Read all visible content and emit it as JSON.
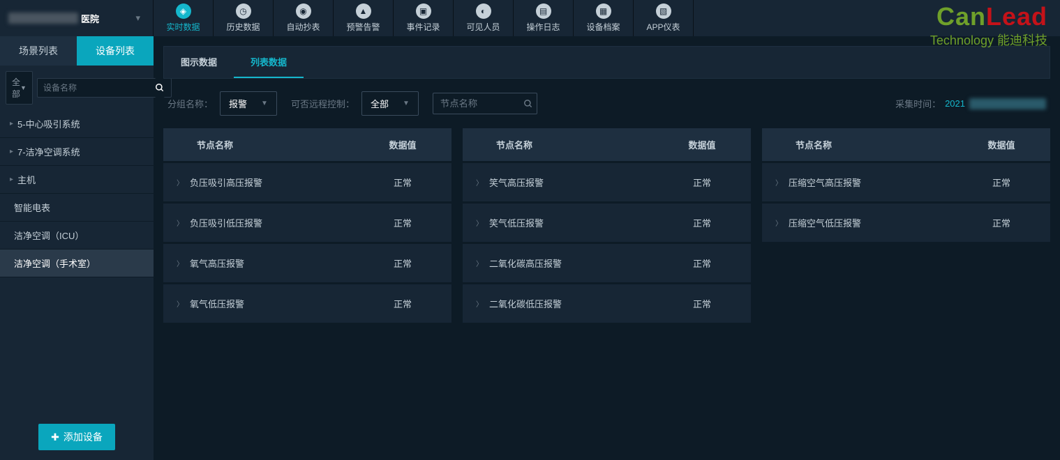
{
  "header": {
    "hospital_suffix": "医院",
    "nav": [
      {
        "label": "实时数据",
        "active": true
      },
      {
        "label": "历史数据",
        "active": false
      },
      {
        "label": "自动抄表",
        "active": false
      },
      {
        "label": "预警告警",
        "active": false
      },
      {
        "label": "事件记录",
        "active": false
      },
      {
        "label": "可见人员",
        "active": false
      },
      {
        "label": "操作日志",
        "active": false
      },
      {
        "label": "设备档案",
        "active": false
      },
      {
        "label": "APP仪表",
        "active": false
      }
    ],
    "logo_sub": "Technology 能迪科技"
  },
  "sidebar": {
    "tabs": [
      {
        "label": "场景列表",
        "active": false
      },
      {
        "label": "设备列表",
        "active": true
      }
    ],
    "filter_all": "全部",
    "search_placeholder": "设备名称",
    "tree": [
      {
        "label": "5-中心吸引系统",
        "selected": false,
        "caret": true
      },
      {
        "label": "7-洁净空调系统",
        "selected": false,
        "caret": true
      },
      {
        "label": "主机",
        "selected": false,
        "caret": true
      },
      {
        "label": "智能电表",
        "selected": false,
        "caret": false
      },
      {
        "label": "洁净空调（ICU）",
        "selected": false,
        "caret": false
      },
      {
        "label": "洁净空调（手术室）",
        "selected": true,
        "caret": false
      }
    ],
    "add_device": "添加设备"
  },
  "main": {
    "sub_tabs": [
      {
        "label": "图示数据",
        "active": false
      },
      {
        "label": "列表数据",
        "active": true
      }
    ],
    "filters": {
      "group_label": "分组名称：",
      "group_value": "报警",
      "remote_label": "可否远程控制：",
      "remote_value": "全部",
      "node_search_placeholder": "节点名称"
    },
    "collect_label": "采集时间：",
    "collect_year": "2021",
    "column_headers": {
      "name": "节点名称",
      "value": "数据值"
    },
    "columns": [
      [
        {
          "name": "负压吸引高压报警",
          "value": "正常"
        },
        {
          "name": "负压吸引低压报警",
          "value": "正常"
        },
        {
          "name": "氧气高压报警",
          "value": "正常"
        },
        {
          "name": "氧气低压报警",
          "value": "正常"
        }
      ],
      [
        {
          "name": "笑气高压报警",
          "value": "正常"
        },
        {
          "name": "笑气低压报警",
          "value": "正常"
        },
        {
          "name": "二氧化碳高压报警",
          "value": "正常"
        },
        {
          "name": "二氧化碳低压报警",
          "value": "正常"
        }
      ],
      [
        {
          "name": "压缩空气高压报警",
          "value": "正常"
        },
        {
          "name": "压缩空气低压报警",
          "value": "正常"
        }
      ]
    ]
  }
}
